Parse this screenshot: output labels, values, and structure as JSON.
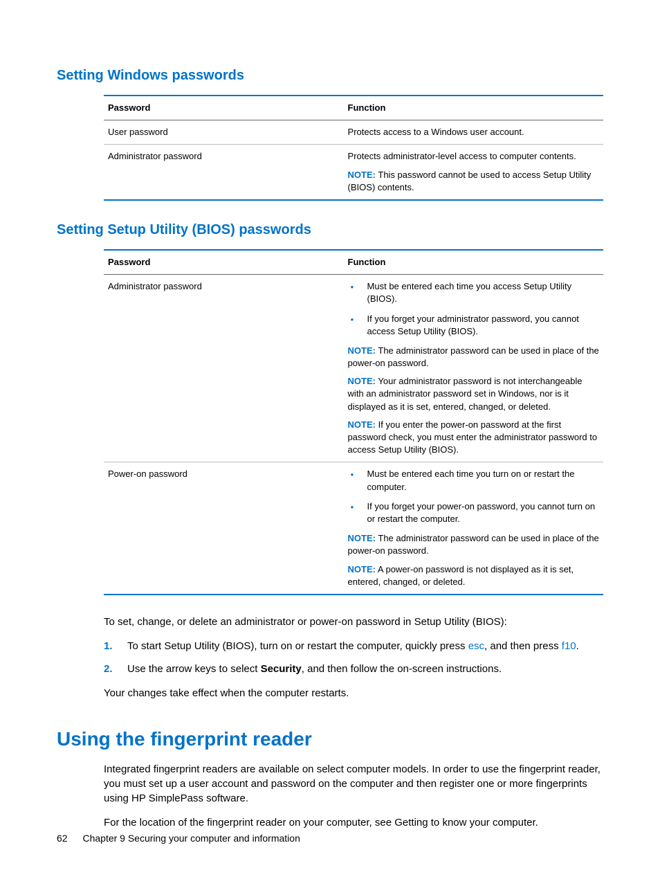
{
  "section1": {
    "heading": "Setting Windows passwords",
    "table": {
      "headers": [
        "Password",
        "Function"
      ],
      "rows": [
        {
          "password": "User password",
          "function": "Protects access to a Windows user account."
        },
        {
          "password": "Administrator password",
          "function": "Protects administrator-level access to computer contents.",
          "note_label": "NOTE:",
          "note": "This password cannot be used to access Setup Utility (BIOS) contents."
        }
      ]
    }
  },
  "section2": {
    "heading": "Setting Setup Utility (BIOS) passwords",
    "table": {
      "headers": [
        "Password",
        "Function"
      ],
      "rows": [
        {
          "password": "Administrator password",
          "bullets": [
            "Must be entered each time you access Setup Utility (BIOS).",
            "If you forget your administrator password, you cannot access Setup Utility (BIOS)."
          ],
          "notes": [
            {
              "label": "NOTE:",
              "text": "The administrator password can be used in place of the power-on password."
            },
            {
              "label": "NOTE:",
              "text": "Your administrator password is not interchangeable with an administrator password set in Windows, nor is it displayed as it is set, entered, changed, or deleted."
            },
            {
              "label": "NOTE:",
              "text": "If you enter the power-on password at the first password check, you must enter the administrator password to access Setup Utility (BIOS)."
            }
          ]
        },
        {
          "password": "Power-on password",
          "bullets": [
            "Must be entered each time you turn on or restart the computer.",
            "If you forget your power-on password, you cannot turn on or restart the computer."
          ],
          "notes": [
            {
              "label": "NOTE:",
              "text": "The administrator password can be used in place of the power-on password."
            },
            {
              "label": "NOTE:",
              "text": "A power-on password is not displayed as it is set, entered, changed, or deleted."
            }
          ]
        }
      ]
    },
    "intro_para": "To set, change, or delete an administrator or power-on password in Setup Utility (BIOS):",
    "steps": [
      {
        "num": "1.",
        "pre": "To start Setup Utility (BIOS), turn on or restart the computer, quickly press ",
        "kbd1": "esc",
        "mid": ", and then press ",
        "kbd2": "f10",
        "post": "."
      },
      {
        "num": "2.",
        "pre": "Use the arrow keys to select ",
        "bold": "Security",
        "post": ", and then follow the on-screen instructions."
      }
    ],
    "closing": "Your changes take effect when the computer restarts."
  },
  "section3": {
    "heading": "Using the fingerprint reader",
    "para1": "Integrated fingerprint readers are available on select computer models. In order to use the fingerprint reader, you must set up a user account and password on the computer and then register one or more fingerprints using HP SimplePass software.",
    "para2": "For the location of the fingerprint reader on your computer, see Getting to know your computer."
  },
  "footer": {
    "page": "62",
    "chapter": "Chapter 9   Securing your computer and information"
  }
}
